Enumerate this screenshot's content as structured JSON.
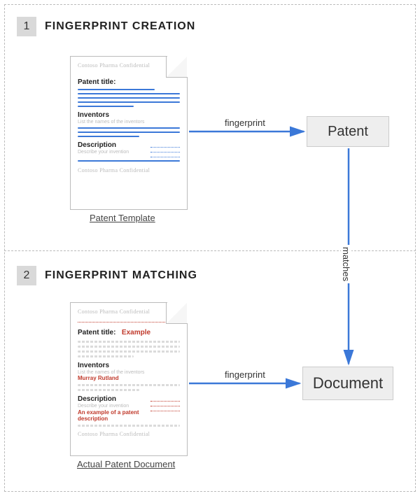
{
  "step1": {
    "num": "1",
    "title": "FINGERPRINT CREATION"
  },
  "step2": {
    "num": "2",
    "title": "FINGERPRINT MATCHING"
  },
  "nodes": {
    "patent": "Patent",
    "document": "Document"
  },
  "edges": {
    "fp1": "fingerprint",
    "matches": "matches",
    "fp2": "fingerprint"
  },
  "captions": {
    "template": "Patent Template",
    "actual": "Actual Patent Document"
  },
  "doc1": {
    "confidential": "Contoso Pharma Confidential",
    "title_label": "Patent title:",
    "inventors_label": "Inventors",
    "inventors_sub": "List the names of the inventors",
    "description_label": "Description",
    "description_sub": "Describe your invention"
  },
  "doc2": {
    "confidential": "Contoso Pharma Confidential",
    "title_label": "Patent title:",
    "title_value": "Example",
    "inventors_label": "Inventors",
    "inventors_sub": "List the names of the inventors",
    "inventor_value": "Murray Rutland",
    "description_label": "Description",
    "description_sub": "Describe your invention",
    "description_value": "An example of a patent description"
  }
}
